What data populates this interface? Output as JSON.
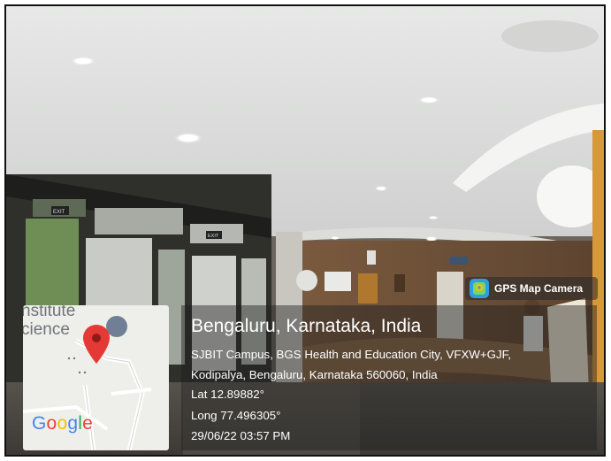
{
  "badge": {
    "label": "GPS Map Camera",
    "icon": "map-pin-icon",
    "color": "#2f9ee0"
  },
  "map": {
    "place_text_1": "nstitute",
    "place_text_2": "cience",
    "logo_letters": [
      {
        "char": "G",
        "color": "#4285F4"
      },
      {
        "char": "o",
        "color": "#EA4335"
      },
      {
        "char": "o",
        "color": "#FBBC05"
      },
      {
        "char": "g",
        "color": "#4285F4"
      },
      {
        "char": "l",
        "color": "#34A853"
      },
      {
        "char": "e",
        "color": "#EA4335"
      }
    ],
    "pin_icon": "location-pin-icon",
    "pin_color": "#e53935"
  },
  "info": {
    "title": "Bengaluru, Karnataka, India",
    "address_line_1": "SJBIT Campus, BGS Health and Education City, VFXW+GJF,",
    "address_line_2": "Kodipalya, Bengaluru, Karnataka 560060, India",
    "latitude": "Lat 12.89882°",
    "longitude": "Long 77.496305°",
    "datetime": "29/06/22 03:57 PM"
  },
  "scene": {
    "exit_sign_1": "EXIT",
    "exit_sign_2": "EXIT"
  }
}
